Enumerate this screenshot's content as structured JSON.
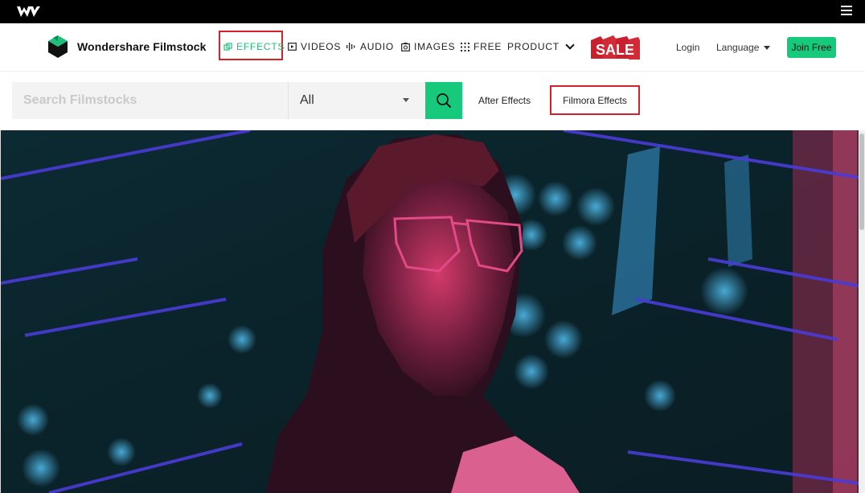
{
  "topbar": {
    "logo_icon": "wondershare-logo-icon",
    "menu_icon": "hamburger-menu-icon"
  },
  "brand": {
    "name": "Wondershare Filmstock",
    "icon": "filmstock-cube-icon"
  },
  "nav": {
    "effects": "EFFECTS",
    "videos": "VIDEOS",
    "audio": "AUDIO",
    "images": "IMAGES",
    "free": "FREE",
    "product": "PRODUCT"
  },
  "sale_badge": "SALE",
  "login": "Login",
  "language": "Language",
  "join_free": "Join Free",
  "search": {
    "placeholder": "Search Filmstocks",
    "category": "All",
    "tags": [
      "After Effects",
      "Filmora Effects"
    ]
  },
  "colors": {
    "accent": "#17c97b",
    "highlight_box": "#d6202c",
    "sale_red": "#c8202e"
  }
}
